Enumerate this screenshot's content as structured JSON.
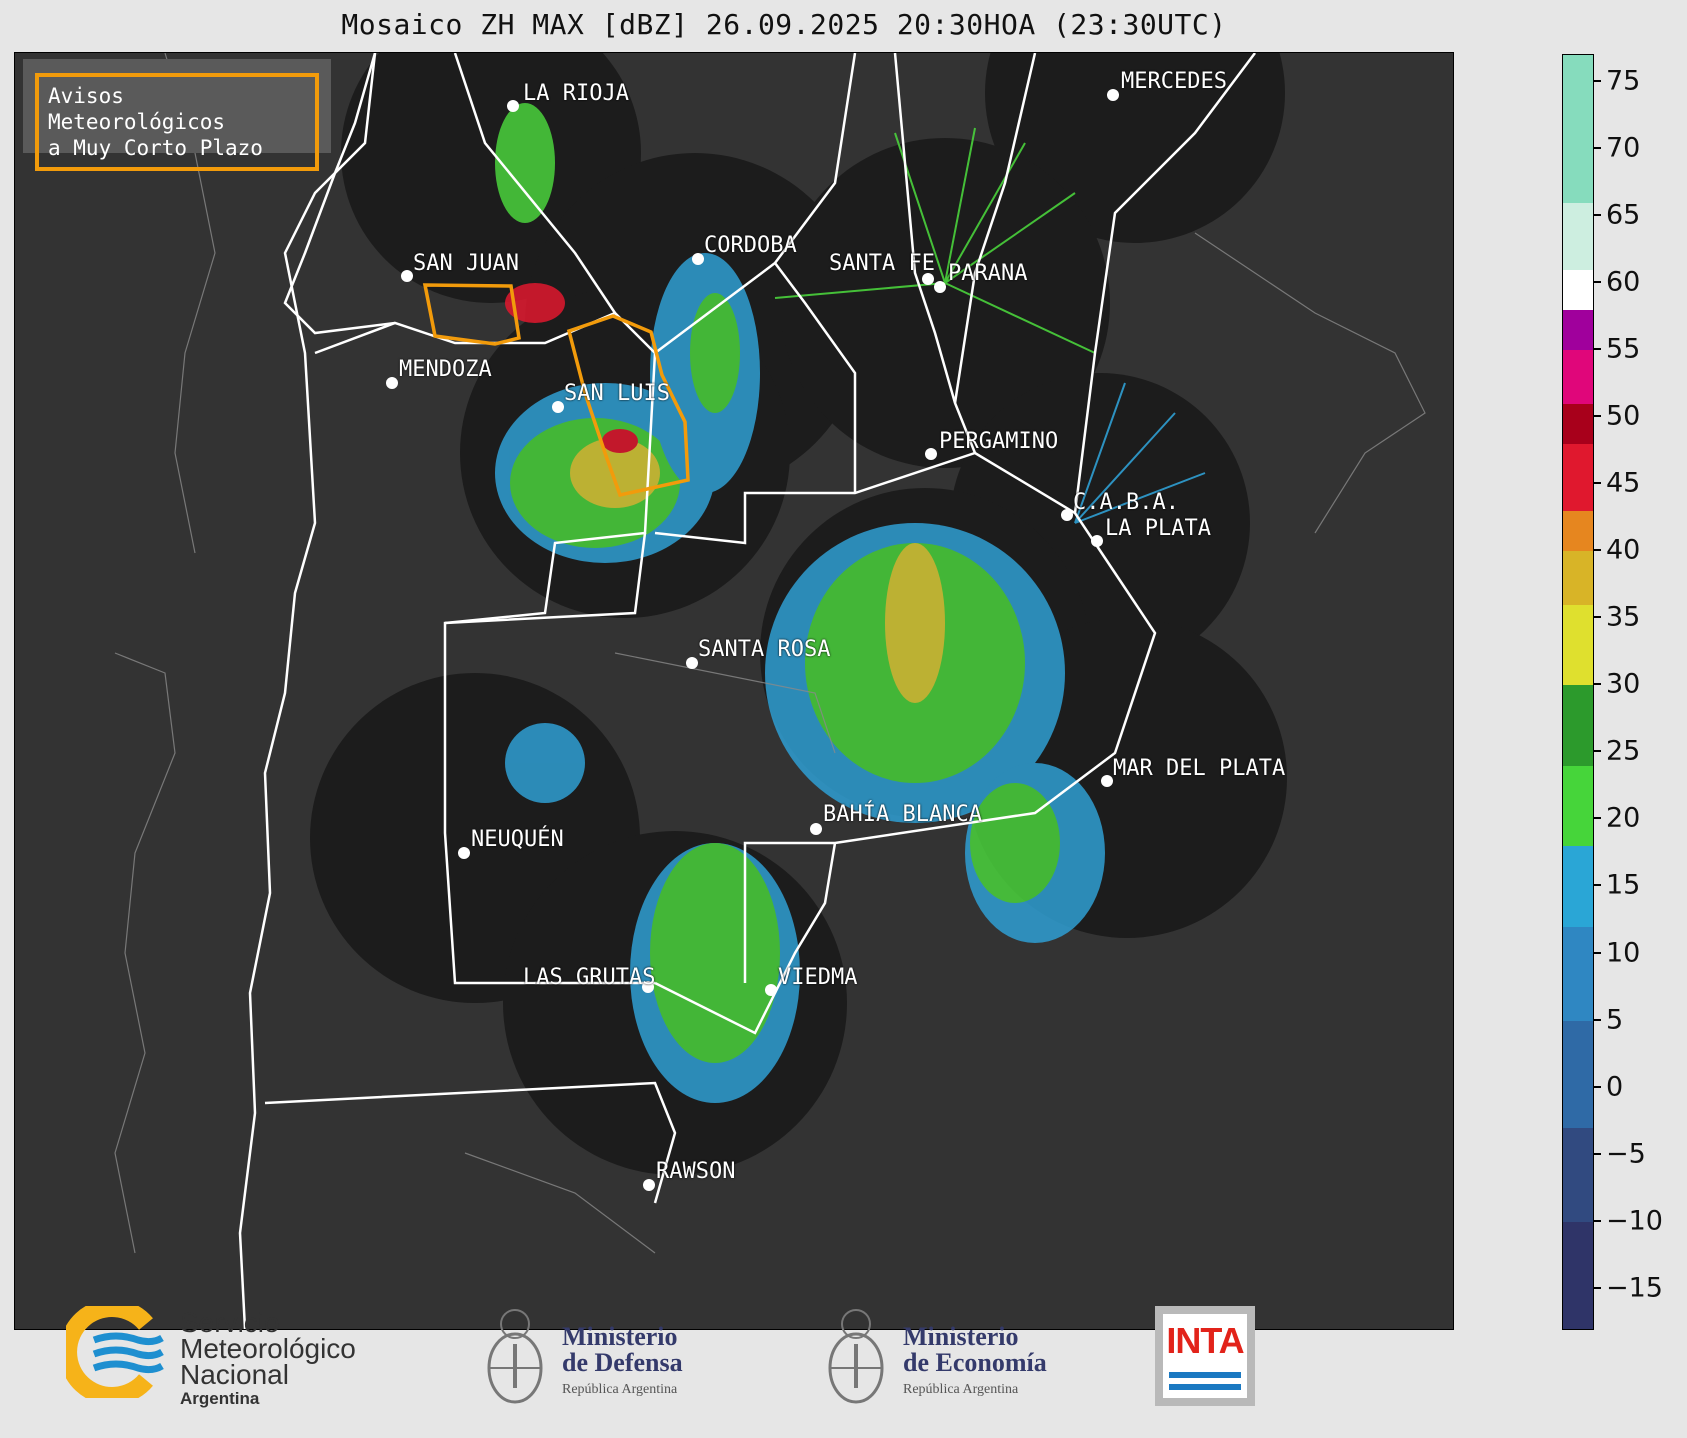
{
  "title": "Mosaico ZH MAX [dBZ] 26.09.2025 20:30HOA (23:30UTC)",
  "legend_box": {
    "line1": "Avisos Meteorológicos",
    "line2": "a Muy Corto Plazo",
    "border_color": "#f29b0b"
  },
  "cities": [
    {
      "name": "LA RIOJA"
    },
    {
      "name": "MERCEDES"
    },
    {
      "name": "CORDOBA"
    },
    {
      "name": "SANTA FE"
    },
    {
      "name": "PARANA"
    },
    {
      "name": "SAN JUAN"
    },
    {
      "name": "MENDOZA"
    },
    {
      "name": "SAN LUIS"
    },
    {
      "name": "PERGAMINO"
    },
    {
      "name": "C.A.B.A."
    },
    {
      "name": "LA PLATA"
    },
    {
      "name": "SANTA ROSA"
    },
    {
      "name": "MAR DEL PLATA"
    },
    {
      "name": "BAHÍA BLANCA"
    },
    {
      "name": "NEUQUÉN"
    },
    {
      "name": "LAS GRUTAS"
    },
    {
      "name": "VIEDMA"
    },
    {
      "name": "RAWSON"
    }
  ],
  "colorbar": {
    "unit": "dBZ",
    "ticks": [
      "75",
      "70",
      "65",
      "60",
      "55",
      "50",
      "45",
      "40",
      "35",
      "30",
      "25",
      "20",
      "15",
      "10",
      "5",
      "0",
      "−5",
      "−10",
      "−15"
    ],
    "range": [
      -18,
      77
    ]
  },
  "footer": {
    "smn": {
      "line1": "Servicio",
      "line2": "Meteorológico",
      "line3": "Nacional",
      "sub": "Argentina"
    },
    "defensa": {
      "line1": "Ministerio",
      "line2": "de Defensa",
      "sub": "República Argentina"
    },
    "economia": {
      "line1": "Ministerio",
      "line2": "de Economía",
      "sub": "República Argentina"
    },
    "inta": {
      "text": "INTA"
    }
  },
  "colors": {
    "map_background": "#333333",
    "radar_disc": "#1c1c1c",
    "boundaries": "#ffffff",
    "warning_polygon": "#f29b0b"
  }
}
